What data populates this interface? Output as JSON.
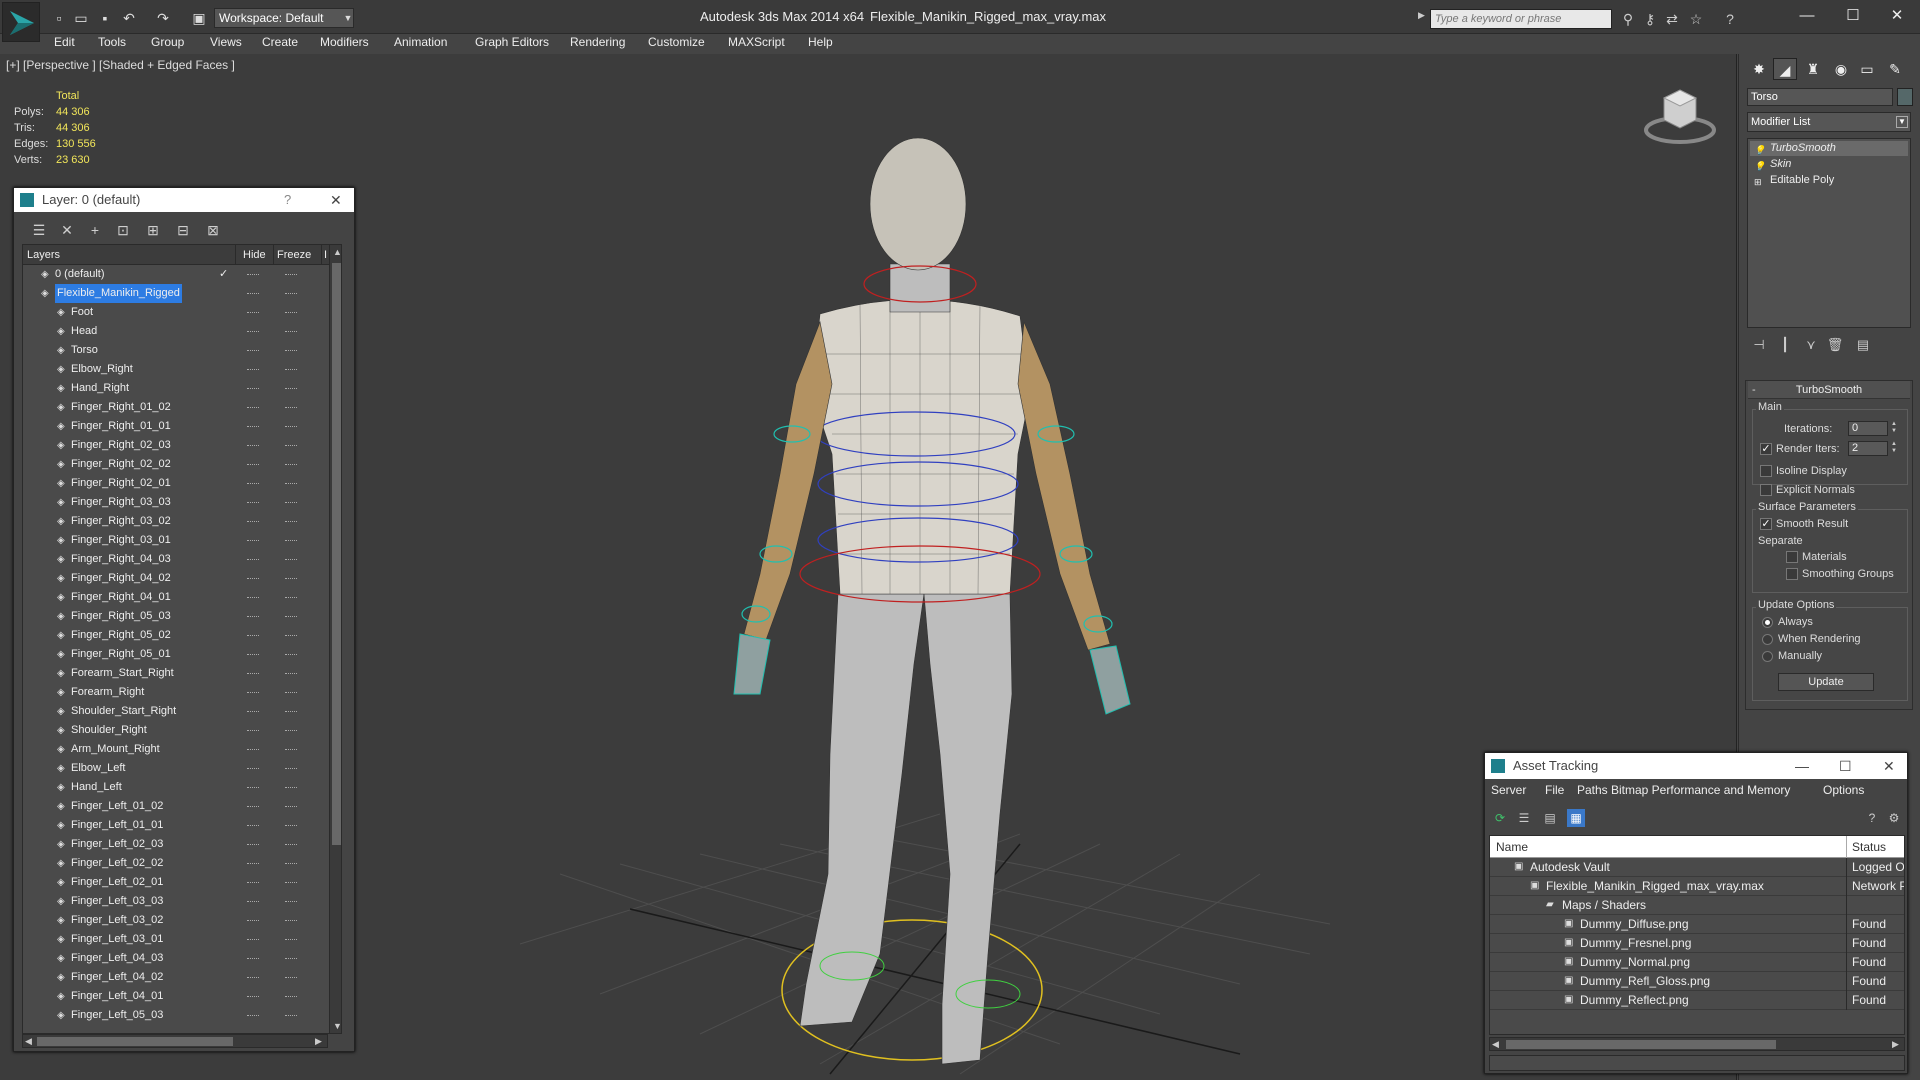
{
  "titlebar": {
    "app_name": "Autodesk 3ds Max  2014 x64",
    "file_name": "Flexible_Manikin_Rigged_max_vray.max",
    "workspace": "Workspace: Default",
    "search_placeholder": "Type a keyword or phrase"
  },
  "menu": [
    "Edit",
    "Tools",
    "Group",
    "Views",
    "Create",
    "Modifiers",
    "Animation",
    "Graph Editors",
    "Rendering",
    "Customize",
    "MAXScript",
    "Help"
  ],
  "viewport": {
    "label": "[+] [Perspective ] [Shaded + Edged Faces ]",
    "stats": {
      "total_label": "Total",
      "polys_label": "Polys:",
      "polys": "44 306",
      "tris_label": "Tris:",
      "tris": "44 306",
      "edges_label": "Edges:",
      "edges": "130 556",
      "verts_label": "Verts:",
      "verts": "23 630"
    }
  },
  "command_panel": {
    "object_name": "Torso",
    "modifier_list": "Modifier List",
    "stack": [
      "TurboSmooth",
      "Skin",
      "Editable Poly"
    ],
    "rollout": {
      "title": "TurboSmooth",
      "main_label": "Main",
      "iterations_label": "Iterations:",
      "iterations": "0",
      "render_iters_label": "Render Iters:",
      "render_iters": "2",
      "isoline": "Isoline Display",
      "explicit_normals": "Explicit Normals",
      "surface_params": "Surface Parameters",
      "smooth_result": "Smooth Result",
      "separate": "Separate",
      "materials": "Materials",
      "smoothing_groups": "Smoothing Groups",
      "update_options": "Update Options",
      "always": "Always",
      "when_rendering": "When Rendering",
      "manually": "Manually",
      "update_button": "Update"
    }
  },
  "layer_panel": {
    "title": "Layer: 0 (default)",
    "help": "?",
    "columns": {
      "layers": "Layers",
      "hide": "Hide",
      "freeze": "Freeze",
      "render": "I"
    },
    "default_layer": "0 (default)",
    "selected_layer": "Flexible_Manikin_Rigged",
    "objects": [
      "Foot",
      "Head",
      "Torso",
      "Elbow_Right",
      "Hand_Right",
      "Finger_Right_01_02",
      "Finger_Right_01_01",
      "Finger_Right_02_03",
      "Finger_Right_02_02",
      "Finger_Right_02_01",
      "Finger_Right_03_03",
      "Finger_Right_03_02",
      "Finger_Right_03_01",
      "Finger_Right_04_03",
      "Finger_Right_04_02",
      "Finger_Right_04_01",
      "Finger_Right_05_03",
      "Finger_Right_05_02",
      "Finger_Right_05_01",
      "Forearm_Start_Right",
      "Forearm_Right",
      "Shoulder_Start_Right",
      "Shoulder_Right",
      "Arm_Mount_Right",
      "Elbow_Left",
      "Hand_Left",
      "Finger_Left_01_02",
      "Finger_Left_01_01",
      "Finger_Left_02_03",
      "Finger_Left_02_02",
      "Finger_Left_02_01",
      "Finger_Left_03_03",
      "Finger_Left_03_02",
      "Finger_Left_03_01",
      "Finger_Left_04_03",
      "Finger_Left_04_02",
      "Finger_Left_04_01",
      "Finger_Left_05_03"
    ]
  },
  "asset_panel": {
    "title": "Asset Tracking",
    "menu": [
      "Server",
      "File",
      "Paths",
      "Bitmap Performance and Memory",
      "Options"
    ],
    "columns": {
      "name": "Name",
      "status": "Status"
    },
    "rows": [
      {
        "name": "Autodesk Vault",
        "status": "Logged Out"
      },
      {
        "name": "Flexible_Manikin_Rigged_max_vray.max",
        "status": "Network Path"
      },
      {
        "name": "Maps / Shaders",
        "status": ""
      },
      {
        "name": "Dummy_Diffuse.png",
        "status": "Found"
      },
      {
        "name": "Dummy_Fresnel.png",
        "status": "Found"
      },
      {
        "name": "Dummy_Normal.png",
        "status": "Found"
      },
      {
        "name": "Dummy_Refl_Gloss.png",
        "status": "Found"
      },
      {
        "name": "Dummy_Reflect.png",
        "status": "Found"
      }
    ]
  },
  "colors": {
    "accent": "#2d7ce3",
    "stats_value": "#f2e65a",
    "teal": "#1e7f8c"
  }
}
